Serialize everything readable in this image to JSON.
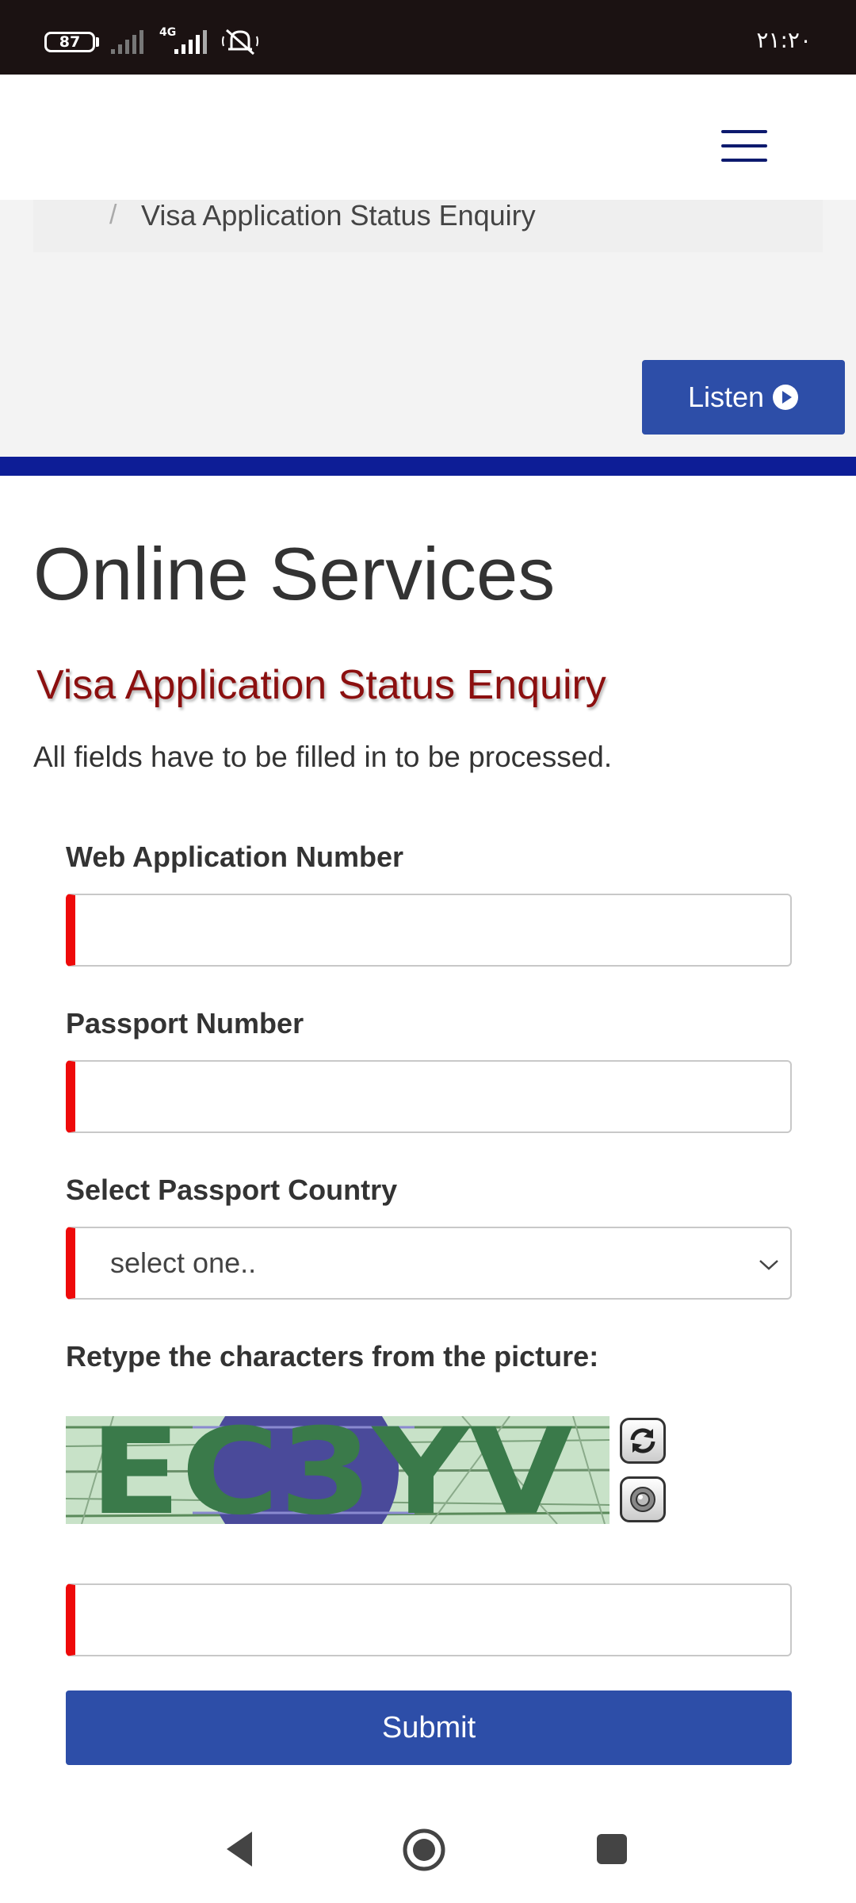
{
  "status_bar": {
    "battery": "87",
    "network": "4G",
    "time": "٢١:٢٠"
  },
  "breadcrumb": {
    "separator": "/",
    "current": "Visa Application Status Enquiry"
  },
  "listen": {
    "label": "Listen"
  },
  "main": {
    "title": "Online Services",
    "subtitle": "Visa Application Status Enquiry",
    "note": "All fields have to be filled in to be processed."
  },
  "form": {
    "web_app_number_label": "Web Application Number",
    "web_app_number_value": "",
    "passport_number_label": "Passport Number",
    "passport_number_value": "",
    "country_label": "Select Passport Country",
    "country_selected": "select one..",
    "captcha_label": "Retype the characters from the picture:",
    "captcha_text": "EC3YV",
    "captcha_value": "",
    "submit_label": "Submit"
  },
  "colors": {
    "accent_blue": "#2d4ea8",
    "rule_blue": "#0d1d96",
    "subtitle_red": "#8b0f0f",
    "required_red": "#ee0a0a"
  },
  "icons": {
    "menu": "hamburger-menu-icon",
    "listen": "play-circle-icon",
    "refresh": "refresh-icon",
    "audio": "speaker-icon"
  }
}
